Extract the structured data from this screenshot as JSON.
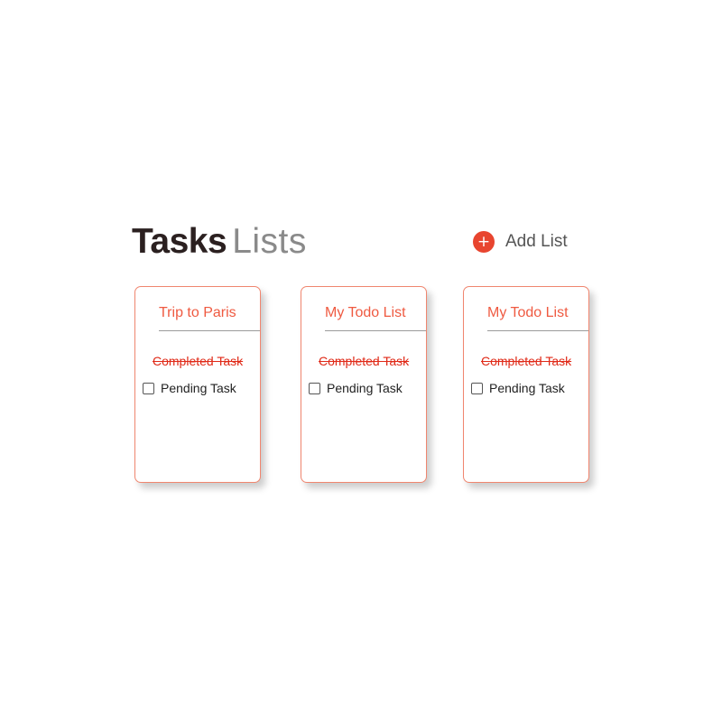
{
  "header": {
    "title_bold": "Tasks",
    "title_light": "Lists",
    "add_list_icon": "plus-icon",
    "add_list_label": "Add List"
  },
  "lists": [
    {
      "title": "Trip to Paris",
      "completed_task": "Completed Task",
      "pending_task": "Pending Task"
    },
    {
      "title": "My Todo List",
      "completed_task": "Completed Task",
      "pending_task": "Pending Task"
    },
    {
      "title": "My Todo List",
      "completed_task": "Completed Task",
      "pending_task": "Pending Task"
    }
  ],
  "colors": {
    "accent": "#e8452f",
    "title_dark": "#2b2020",
    "card_border": "#f0866f"
  }
}
